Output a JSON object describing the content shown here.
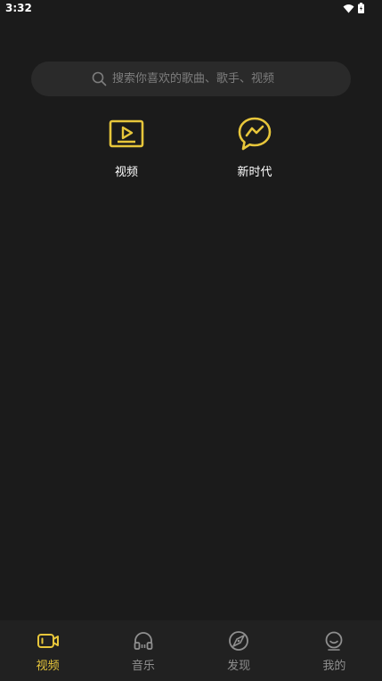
{
  "status_bar": {
    "time": "3:32"
  },
  "search": {
    "placeholder": "搜索你喜欢的歌曲、歌手、视频"
  },
  "entries": [
    {
      "label": "视频",
      "icon": "video-play-icon"
    },
    {
      "label": "新时代",
      "icon": "chat-bolt-icon"
    }
  ],
  "bottom_nav": {
    "items": [
      {
        "label": "视频",
        "icon": "video-camera-icon",
        "active": true
      },
      {
        "label": "音乐",
        "icon": "headphones-icon",
        "active": false
      },
      {
        "label": "发现",
        "icon": "compass-icon",
        "active": false
      },
      {
        "label": "我的",
        "icon": "smiley-icon",
        "active": false
      }
    ]
  },
  "colors": {
    "accent": "#e7c63b",
    "background": "#1b1b1b",
    "search_bg": "#2a2a2a",
    "nav_bg": "#212121",
    "inactive": "#8f8f8f"
  }
}
